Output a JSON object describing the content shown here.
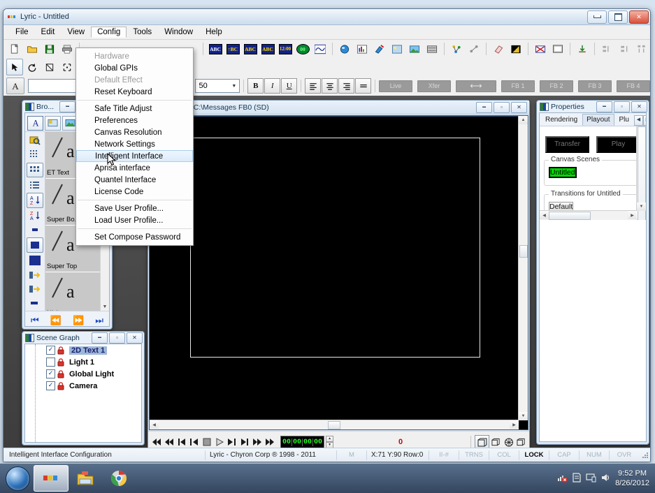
{
  "window": {
    "title": "Lyric - Untitled",
    "buttons": {
      "minimize": "minimize",
      "maximize": "maximize",
      "close": "close"
    }
  },
  "menubar": {
    "items": [
      "File",
      "Edit",
      "View",
      "Config",
      "Tools",
      "Window",
      "Help"
    ],
    "open_index": 3
  },
  "config_menu": {
    "groups": [
      [
        {
          "label": "Hardware",
          "enabled": false
        },
        {
          "label": "Global GPIs",
          "enabled": true
        },
        {
          "label": "Default Effect",
          "enabled": false
        },
        {
          "label": "Reset Keyboard",
          "enabled": true
        }
      ],
      [
        {
          "label": "Safe Title Adjust",
          "enabled": true
        },
        {
          "label": "Preferences",
          "enabled": true
        },
        {
          "label": "Canvas Resolution",
          "enabled": true
        },
        {
          "label": "Network Settings",
          "enabled": true
        },
        {
          "label": "Intelligent Interface",
          "enabled": true,
          "highlighted": true
        },
        {
          "label": "Aprisa interface",
          "enabled": true
        },
        {
          "label": "Quantel Interface",
          "enabled": true
        },
        {
          "label": "License Code",
          "enabled": true
        }
      ],
      [
        {
          "label": "Save User Profile...",
          "enabled": true
        },
        {
          "label": "Load User Profile...",
          "enabled": true
        }
      ],
      [
        {
          "label": "Set Compose Password",
          "enabled": true
        }
      ]
    ]
  },
  "toolbar": {
    "row1_icons": [
      "new-icon",
      "open-icon",
      "save-icon",
      "print-icon"
    ],
    "text_icons": [
      "ABC",
      "ABC",
      "ABC",
      "ABC",
      "12:00",
      "00"
    ],
    "row2_icons": [
      "pointer-icon",
      "rotate-icon",
      "scale-icon",
      "move-icon"
    ],
    "font_combo_value": "",
    "size_combo_value": "50",
    "style_buttons": [
      "B",
      "I",
      "U"
    ],
    "align_buttons": [
      "align-left",
      "align-center",
      "align-right",
      "align-justify"
    ],
    "playout_buttons": [
      "Live",
      "Xfer",
      "⟷",
      "FB 1",
      "FB 2",
      "FB 3",
      "FB 4"
    ]
  },
  "browser": {
    "title": "Bro...",
    "tabs": [
      "text-tab",
      "card-tab",
      "image-tab"
    ],
    "items": [
      {
        "label": "ET Text"
      },
      {
        "label": "Super Bo..."
      },
      {
        "label": "Super Top"
      },
      {
        "label": "Nickname"
      }
    ],
    "nav": [
      "first",
      "previous",
      "next",
      "last"
    ]
  },
  "scene_graph": {
    "title": "Scene Graph",
    "rows": [
      {
        "name": "2D Text 1",
        "checked": true,
        "locked": true,
        "selected": true
      },
      {
        "name": "Light 1",
        "checked": false,
        "locked": true,
        "selected": false
      },
      {
        "name": "Global Light",
        "checked": true,
        "locked": true,
        "selected": false
      },
      {
        "name": "Camera",
        "checked": true,
        "locked": true,
        "selected": false
      }
    ]
  },
  "canvas_window": {
    "title": "Untitled   Dir: C:\\Messages   FB0 (SD)",
    "transport": {
      "buttons": [
        "rewind-all",
        "rewind",
        "step-back-field",
        "step-back-frame",
        "stop",
        "play",
        "step-forward-frame",
        "step-forward-field",
        "forward",
        "forward-all"
      ],
      "timecode": [
        "00",
        "00",
        "00",
        "00"
      ],
      "frame_number": "0",
      "view_buttons": [
        "box-front-icon",
        "box-icon",
        "box-wire-icon",
        "box-side-icon"
      ]
    }
  },
  "properties": {
    "title": "Properties",
    "tabs": [
      "Rendering",
      "Playout",
      "Plu"
    ],
    "active_tab": "Playout",
    "transfer_button": "Transfer",
    "play_button": "Play",
    "canvas_scenes_label": "Canvas Scenes",
    "scene_name": "Untitled",
    "transitions_label": "Transitions for Untitled",
    "transition_name": "Default",
    "accent_green": "#00d900"
  },
  "statusbar": {
    "message": "Intelligent Interface Configuration",
    "copyright": "Lyric - Chyron Corp ® 1998 - 2011",
    "mode": "M",
    "coords": "X:71  Y:90  Row:0",
    "indicators": [
      {
        "label": "II-#",
        "active": false
      },
      {
        "label": "TRNS",
        "active": false
      },
      {
        "label": "COL",
        "active": false
      },
      {
        "label": "LOCK",
        "active": true
      },
      {
        "label": "CAP",
        "active": false
      },
      {
        "label": "NUM",
        "active": false
      },
      {
        "label": "OVR",
        "active": false
      }
    ]
  },
  "taskbar": {
    "items": [
      {
        "name": "lyric-task",
        "active": true
      },
      {
        "name": "explorer-task",
        "active": false
      },
      {
        "name": "chrome-task",
        "active": false
      }
    ],
    "tray_icons": [
      "network-error-icon",
      "action-center-icon",
      "display-icon",
      "volume-icon"
    ],
    "time": "9:52 PM",
    "date": "8/26/2012"
  }
}
